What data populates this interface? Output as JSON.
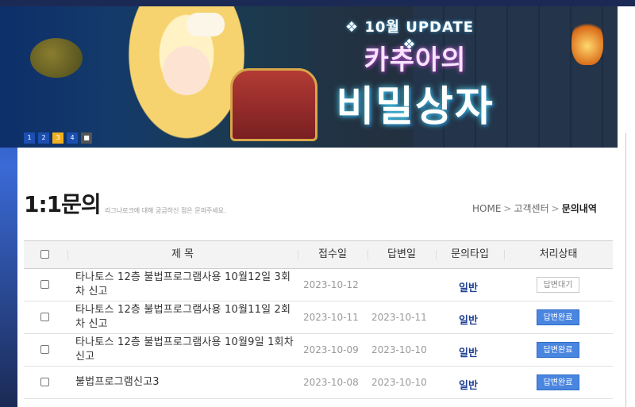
{
  "banner": {
    "update_label": "❖ 10월 UPDATE ❖",
    "title_line1": "카추아의",
    "title_line2": "비밀상자",
    "pager": [
      "1",
      "2",
      "3",
      "4",
      "■"
    ],
    "active_page": 3
  },
  "page": {
    "title": "1:1문의",
    "subtitle": "리그나로크에 대해 궁금하신 점은 문의주세요.",
    "breadcrumb": {
      "home": "HOME",
      "sep": ">",
      "center": "고객센터",
      "current": "문의내역"
    }
  },
  "table": {
    "headers": {
      "title": "제 목",
      "received": "접수일",
      "answered": "답변일",
      "type": "문의타입",
      "status": "처리상태"
    },
    "rows": [
      {
        "title": "타나토스 12층 불법프로그램사용 10월12일 3회차 신고",
        "received": "2023-10-12",
        "answered": "",
        "type": "일반",
        "status": "답변대기",
        "status_kind": "wait"
      },
      {
        "title": "타나토스 12층 불법프로그램사용 10월11일 2회차 신고",
        "received": "2023-10-11",
        "answered": "2023-10-11",
        "type": "일반",
        "status": "답변완료",
        "status_kind": "done"
      },
      {
        "title": "타나토스 12층 불법프로그램사용 10월9일 1회차 신고",
        "received": "2023-10-09",
        "answered": "2023-10-10",
        "type": "일반",
        "status": "답변완료",
        "status_kind": "done"
      },
      {
        "title": "불법프로그램신고3",
        "received": "2023-10-08",
        "answered": "2023-10-10",
        "type": "일반",
        "status": "답변완료",
        "status_kind": "done"
      }
    ]
  },
  "colors": {
    "accent": "#1e3f93",
    "done_button": "#4a86e0",
    "active_dot": "#f2b01e"
  }
}
